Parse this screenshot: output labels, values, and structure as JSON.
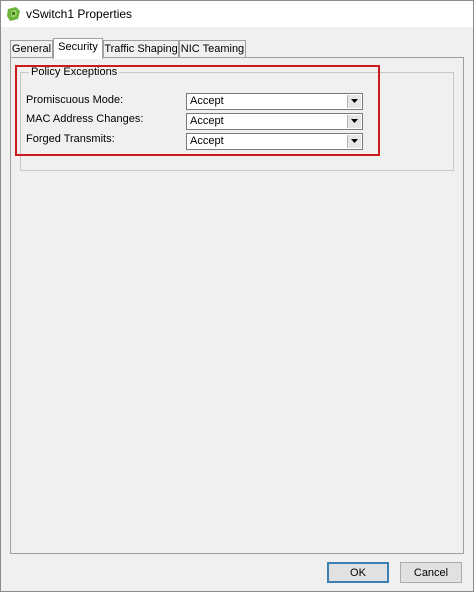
{
  "window": {
    "title": "vSwitch1 Properties",
    "icon": "vmware-vswitch-icon"
  },
  "tabs": [
    {
      "label": "General",
      "active": false
    },
    {
      "label": "Security",
      "active": true
    },
    {
      "label": "Traffic Shaping",
      "active": false
    },
    {
      "label": "NIC Teaming",
      "active": false
    }
  ],
  "policy": {
    "legend": "Policy Exceptions",
    "fields": [
      {
        "label": "Promiscuous Mode:",
        "value": "Accept"
      },
      {
        "label": "MAC Address Changes:",
        "value": "Accept"
      },
      {
        "label": "Forged Transmits:",
        "value": "Accept"
      }
    ]
  },
  "buttons": {
    "ok": "OK",
    "cancel": "Cancel"
  },
  "colors": {
    "highlight": "#cc1a1f",
    "icon_green": "#6bb33a",
    "default_button_border": "#3c7fb1"
  }
}
